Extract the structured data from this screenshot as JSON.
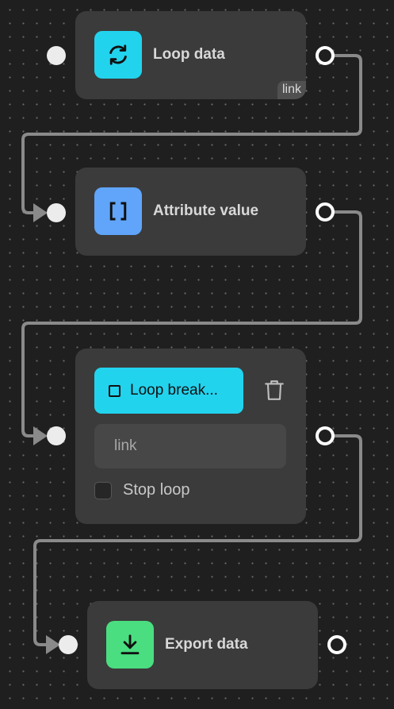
{
  "nodes": {
    "loop_data": {
      "title": "Loop data",
      "tag": "link",
      "icon": "loop-icon",
      "color": "#22d3ee"
    },
    "attribute_value": {
      "title": "Attribute value",
      "icon": "brackets-icon",
      "color": "#60a5fa"
    },
    "loop_breakpoint": {
      "button_label": "Loop break...",
      "button_color": "#22d3ee",
      "input_value": "link",
      "checkbox_label": "Stop loop",
      "checkbox_checked": false
    },
    "export_data": {
      "title": "Export data",
      "icon": "download-icon",
      "color": "#4ade80"
    }
  },
  "colors": {
    "background": "#1f1f1f",
    "node": "#3b3b3b",
    "wire": "#8a8a8a"
  }
}
